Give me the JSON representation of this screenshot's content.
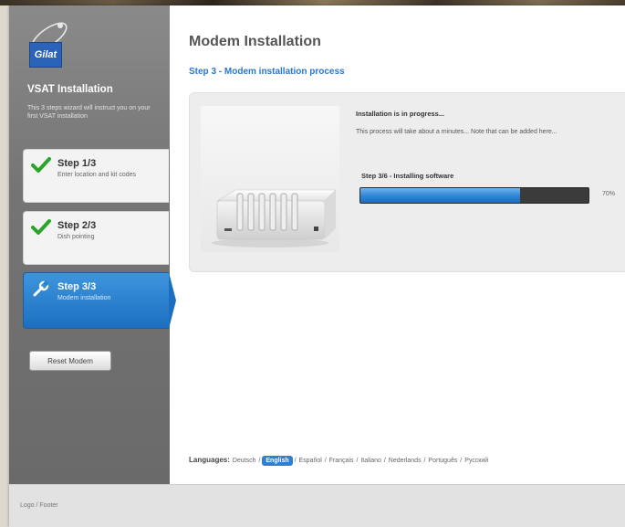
{
  "brand": {
    "logo_text": "Gilat"
  },
  "sidebar": {
    "title": "VSAT Installation",
    "description": "This 3 steps wizard will instruct you on your first VSAT installation",
    "steps": [
      {
        "title": "Step 1/3",
        "desc": "Enter location and kit codes",
        "state": "done"
      },
      {
        "title": "Step 2/3",
        "desc": "Dish pointing",
        "state": "done"
      },
      {
        "title": "Step 3/3",
        "desc": "Modem installation",
        "state": "active"
      }
    ],
    "reset_label": "Reset Modem"
  },
  "main": {
    "title": "Modem Installation",
    "subtitle": "Step 3 - Modem installation process",
    "status_title": "Installation is in progress...",
    "status_desc": "This process will take about a minutes... Note that can be added here...",
    "progress_label": "Step 3/6 - Installing software",
    "progress_percent": 70,
    "progress_text": "70%"
  },
  "languages": {
    "label": "Languages:",
    "items": [
      "Deutsch",
      "English",
      "Español",
      "Français",
      "Italiano",
      "Nederlands",
      "Português",
      "Русский"
    ],
    "selected": "English"
  },
  "footer": {
    "text": "Logo / Footer"
  },
  "colors": {
    "accent": "#2a78c8",
    "active_step": "#1c6fc0",
    "check_green": "#2aa52a",
    "progress_fill": "#2f84d4",
    "progress_track": "#3b3b3b",
    "sidebar_bg": "#747474"
  },
  "icons": {
    "step_done": "checkmark-icon",
    "step_active": "wrench-icon",
    "logo": "satellite-orbit-icon"
  }
}
